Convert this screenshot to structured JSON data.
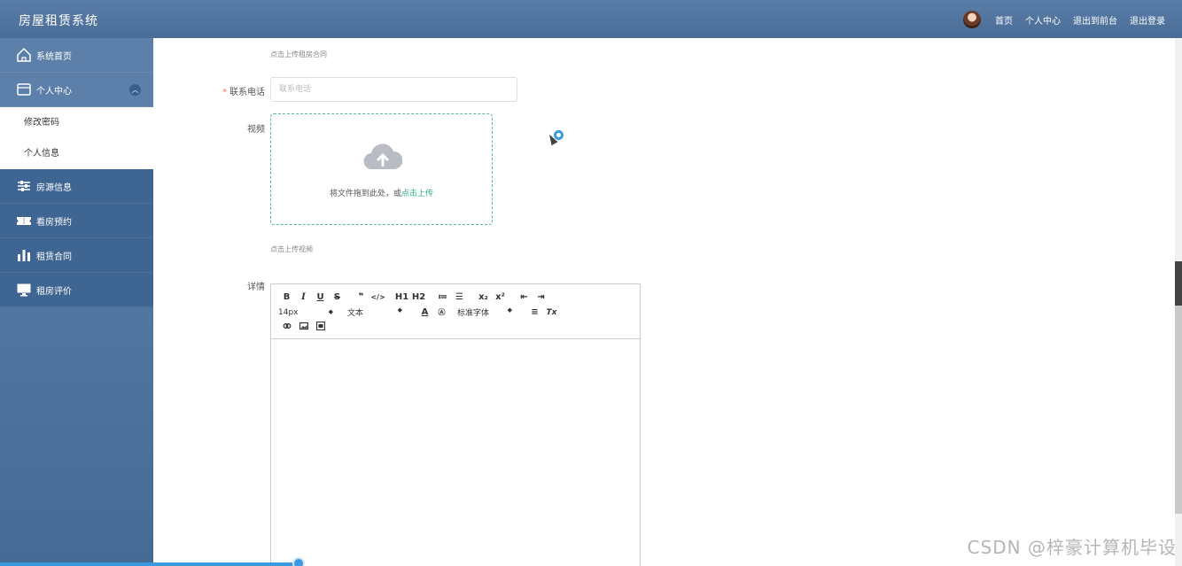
{
  "header": {
    "title": "房屋租赁系统",
    "nav": [
      "首页",
      "个人中心",
      "退出到前台",
      "退出登录"
    ]
  },
  "sidebar": {
    "items": [
      {
        "label": "系统首页",
        "icon": "home-icon"
      },
      {
        "label": "个人中心",
        "icon": "card-icon",
        "submenu": [
          "修改密码",
          "个人信息"
        ]
      },
      {
        "label": "房源信息",
        "icon": "sliders-icon"
      },
      {
        "label": "看房预约",
        "icon": "ticket-icon"
      },
      {
        "label": "租赁合同",
        "icon": "bar-chart-icon"
      },
      {
        "label": "租房评价",
        "icon": "monitor-icon"
      }
    ]
  },
  "form": {
    "contract_upload_hint": "点击上传租房合同",
    "phone_label": "联系电话",
    "phone_required_mark": "*",
    "phone_placeholder": "联系电话",
    "video_label": "视频",
    "upload_text": "将文件拖到此处，或",
    "upload_link": "点击上传",
    "video_upload_hint": "点击上传视频",
    "details_label": "详情"
  },
  "editor": {
    "row1": [
      "B",
      "I",
      "U",
      "S",
      "❞",
      "</>",
      "H1",
      "H2",
      "≔",
      "☰",
      "x₂",
      "x²",
      "⇤",
      "⇥"
    ],
    "font_size": "14px",
    "text_style": "文本",
    "font_family": "标准字体",
    "row2_extras": [
      "A",
      "Ⓐ",
      "≡",
      "Tx"
    ],
    "row3": [
      "link",
      "image",
      "video"
    ]
  },
  "watermark": "CSDN @梓豪计算机毕设",
  "colors": {
    "header": "#4a6d98",
    "sidebar": "#4f74a0",
    "accent_green": "#2bb07a",
    "required_red": "#f56c6c"
  }
}
